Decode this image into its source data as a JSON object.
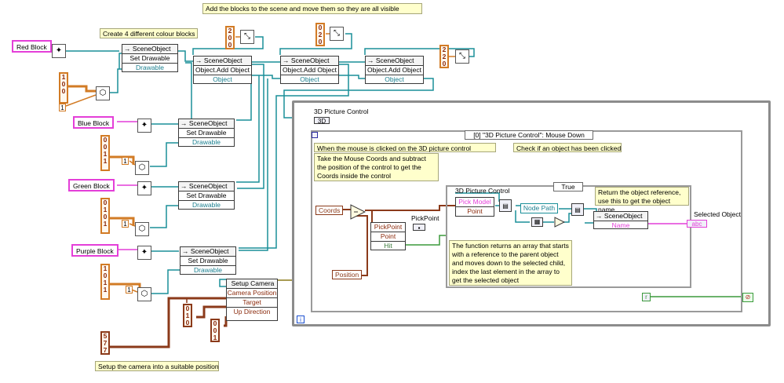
{
  "notes": {
    "top": "Add the blocks to the scene and move them so they are all visible",
    "create": "Create 4 different colour blocks",
    "camera": "Setup the camera into a suitable position",
    "mouse_click": "When the mouse is clicked on the 3D picture control",
    "check_clicked": "Check if an object has been clicked",
    "take_coords": "Take the Mouse Coords and subtract the position of the control to get the Coords inside the control",
    "return_ref": "Return the object reference, use this to get the object name",
    "function_returns": "The function returns an array that starts with a reference to the parent object and moves down to the selected child, index the last element in the array to get the selected object"
  },
  "constants": {
    "red_block": "Red Block",
    "blue_block": "Blue Block",
    "green_block": "Green Block",
    "purple_block": "Purple Block"
  },
  "arrays": {
    "red": [
      "1",
      "0",
      "0"
    ],
    "blue": [
      "0",
      "0",
      "1",
      "1"
    ],
    "green": [
      "0",
      "1",
      "0",
      "1"
    ],
    "purple": [
      "1",
      "0",
      "1",
      "1"
    ],
    "move1": [
      "2",
      "0",
      "0"
    ],
    "move2": [
      "0",
      "2",
      "0"
    ],
    "move3": [
      "2",
      "2",
      "0"
    ],
    "target": [
      "0",
      "0",
      "1"
    ],
    "up_dir": [
      "0",
      "1",
      "0"
    ],
    "camera_pos": [
      "5",
      "7",
      "7"
    ],
    "one": "1"
  },
  "nodes": {
    "sceneobject": "→ SceneObject",
    "set_drawable": "Set Drawable",
    "drawable": "Drawable",
    "add_object": "Object.Add Object",
    "object": "Object",
    "setup_camera": "Setup Camera",
    "camera_position": "Camera Position",
    "target": "Target",
    "up_direction": "Up Direction",
    "pick_model": "Pick Model",
    "point": "Point",
    "node_path": "Node Path",
    "name": "Name",
    "pickpoint": "PickPoint",
    "hit": "Hit",
    "coords": "Coords",
    "position": "Position"
  },
  "structures": {
    "picture_control": "3D Picture Control",
    "event_case": "[0] \"3D Picture Control\": Mouse Down",
    "case_true": "True",
    "inner_picture_control": "3D Picture Control",
    "pickpoint_label": "PickPoint",
    "selected_object": "Selected Object",
    "loop_index": "i",
    "event_terminal": "⊘"
  },
  "colors": {
    "wire_teal": "#1a8f99",
    "wire_orange": "#d27b25",
    "wire_brown": "#8b3a1a",
    "wire_pink": "#e43fd8",
    "wire_green": "#3c9a3c",
    "note_bg": "#ffffcc"
  }
}
